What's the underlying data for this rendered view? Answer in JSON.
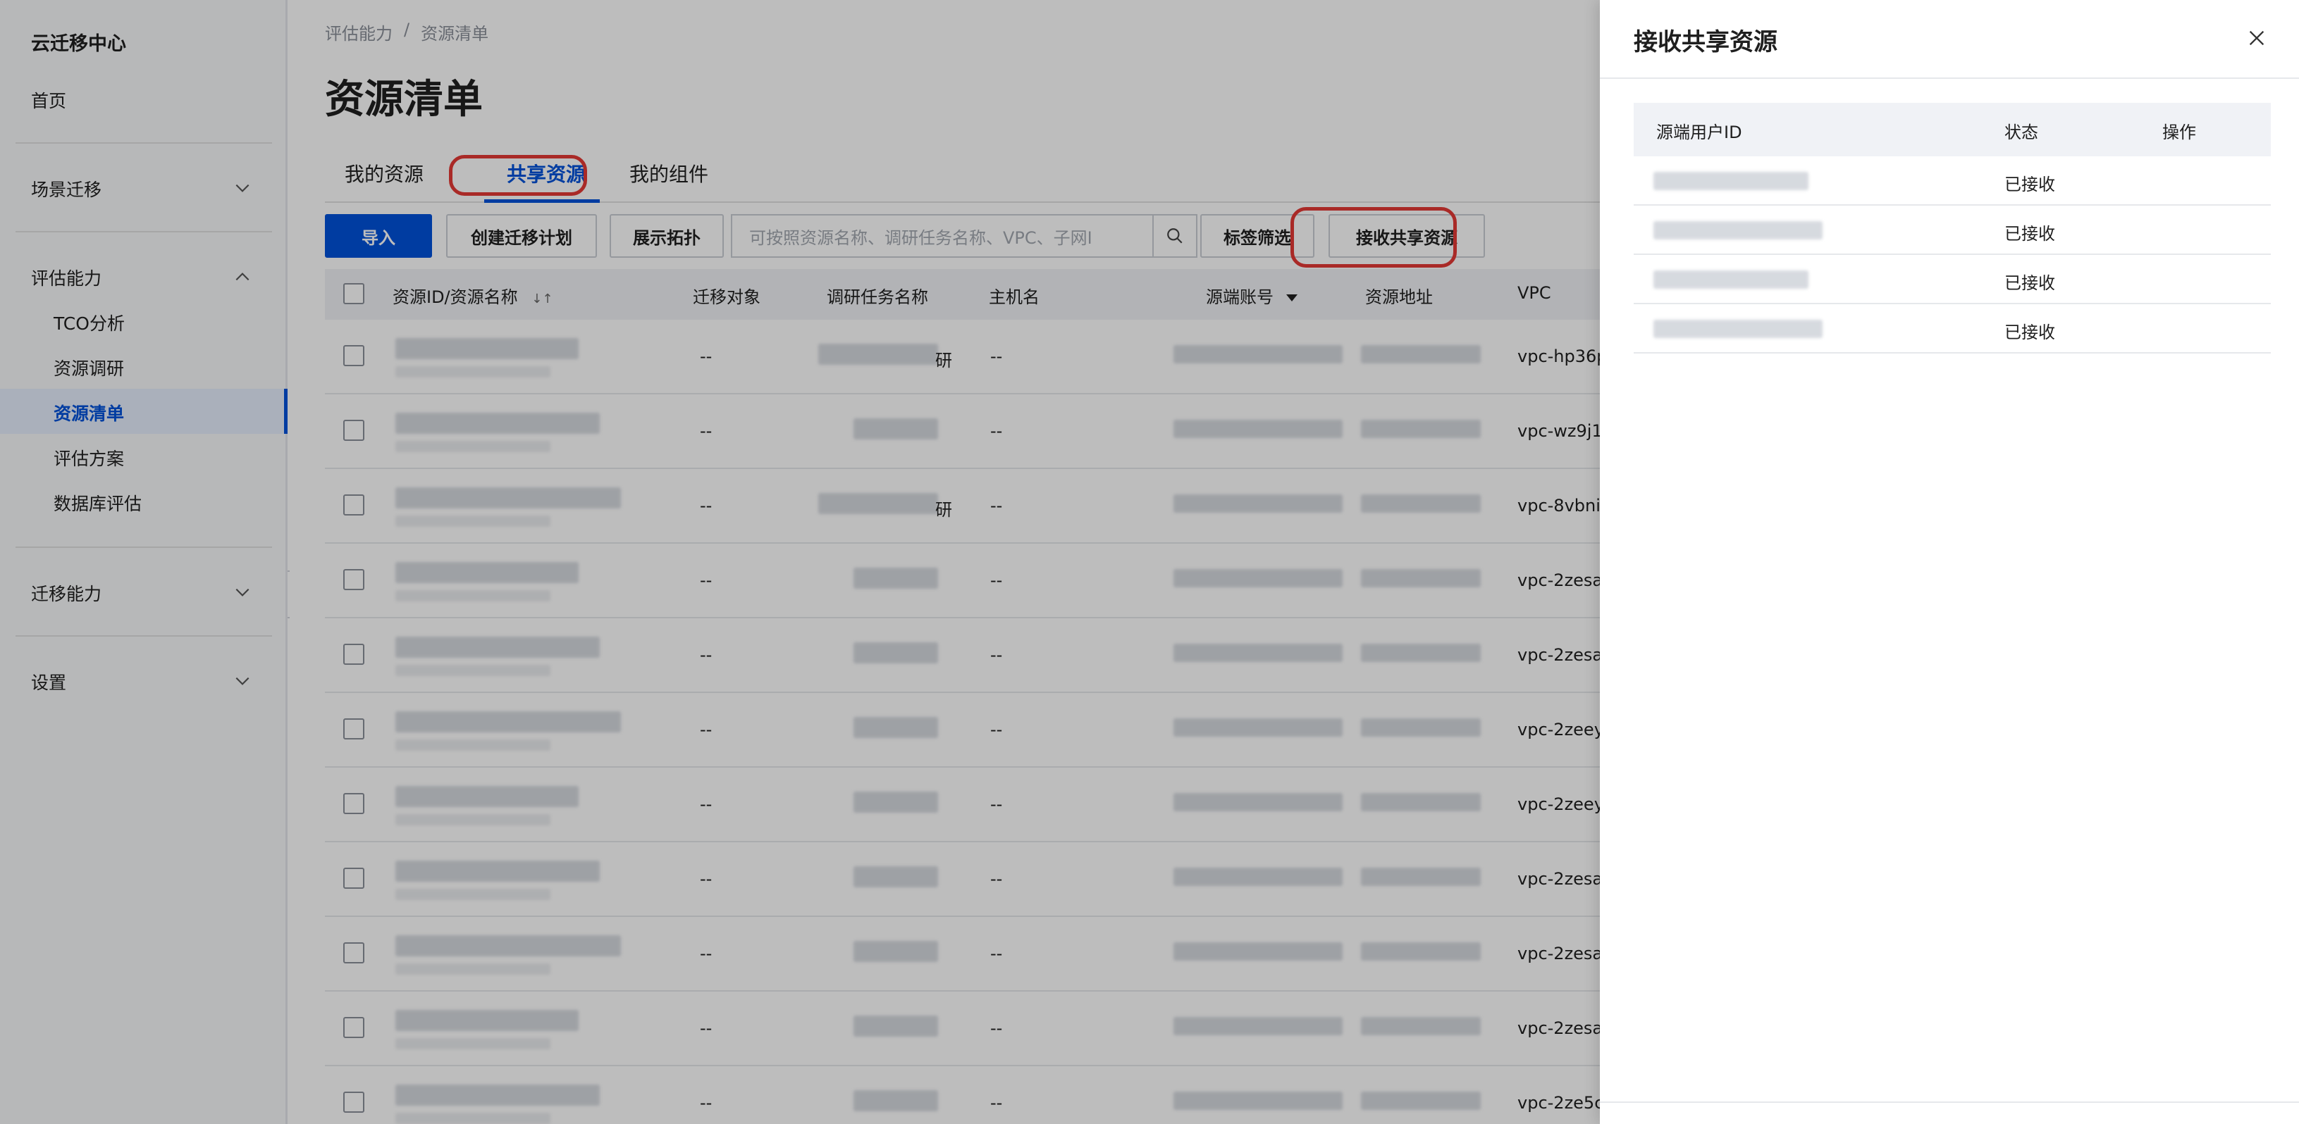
{
  "sidebar": {
    "brand": "云迁移中心",
    "home": "首页",
    "scene_migration": "场景迁移",
    "assessment": "评估能力",
    "assessment_items": [
      "TCO分析",
      "资源调研",
      "资源清单",
      "评估方案",
      "数据库评估"
    ],
    "migration": "迁移能力",
    "settings": "设置"
  },
  "breadcrumb": {
    "parent": "评估能力",
    "separator": "/",
    "current": "资源清单"
  },
  "page_title": "资源清单",
  "tabs": [
    "我的资源",
    "共享资源",
    "我的组件"
  ],
  "toolbar": {
    "import": "导入",
    "create_plan": "创建迁移计划",
    "show_topology": "展示拓扑",
    "search_placeholder": "可按照资源名称、调研任务名称、VPC、子网I",
    "tag_filter": "标签筛选",
    "receive_shared": "接收共享资源"
  },
  "table": {
    "columns": [
      "资源ID/资源名称",
      "迁移对象",
      "调研任务名称",
      "主机名",
      "源端账号",
      "资源地址",
      "VPC"
    ],
    "sort_icon_label": "↓↑",
    "rows": [
      {
        "target": "--",
        "task_suffix": "研",
        "host": "--",
        "vpc": "vpc-hp36p"
      },
      {
        "target": "--",
        "task_suffix": "",
        "host": "--",
        "vpc": "vpc-wz9j1"
      },
      {
        "target": "--",
        "task_suffix": "研",
        "host": "--",
        "vpc": "vpc-8vbni"
      },
      {
        "target": "--",
        "task_suffix": "",
        "host": "--",
        "vpc": "vpc-2zesa"
      },
      {
        "target": "--",
        "task_suffix": "",
        "host": "--",
        "vpc": "vpc-2zesa"
      },
      {
        "target": "--",
        "task_suffix": "",
        "host": "--",
        "vpc": "vpc-2zeey"
      },
      {
        "target": "--",
        "task_suffix": "",
        "host": "--",
        "vpc": "vpc-2zeey"
      },
      {
        "target": "--",
        "task_suffix": "",
        "host": "--",
        "vpc": "vpc-2zesa"
      },
      {
        "target": "--",
        "task_suffix": "",
        "host": "--",
        "vpc": "vpc-2zesa"
      },
      {
        "target": "--",
        "task_suffix": "",
        "host": "--",
        "vpc": "vpc-2zesa"
      },
      {
        "target": "--",
        "task_suffix": "",
        "host": "--",
        "vpc": "vpc-2ze5c"
      }
    ],
    "last_row_extra": "--"
  },
  "drawer": {
    "title": "接收共享资源",
    "columns": [
      "源端用户ID",
      "状态",
      "操作"
    ],
    "rows": [
      {
        "status": "已接收"
      },
      {
        "status": "已接收"
      },
      {
        "status": "已接收"
      },
      {
        "status": "已接收"
      }
    ]
  },
  "colors": {
    "accent": "#0052d9",
    "highlight_ring": "#e53935",
    "overlay": "rgba(0,0,0,0.26)"
  }
}
